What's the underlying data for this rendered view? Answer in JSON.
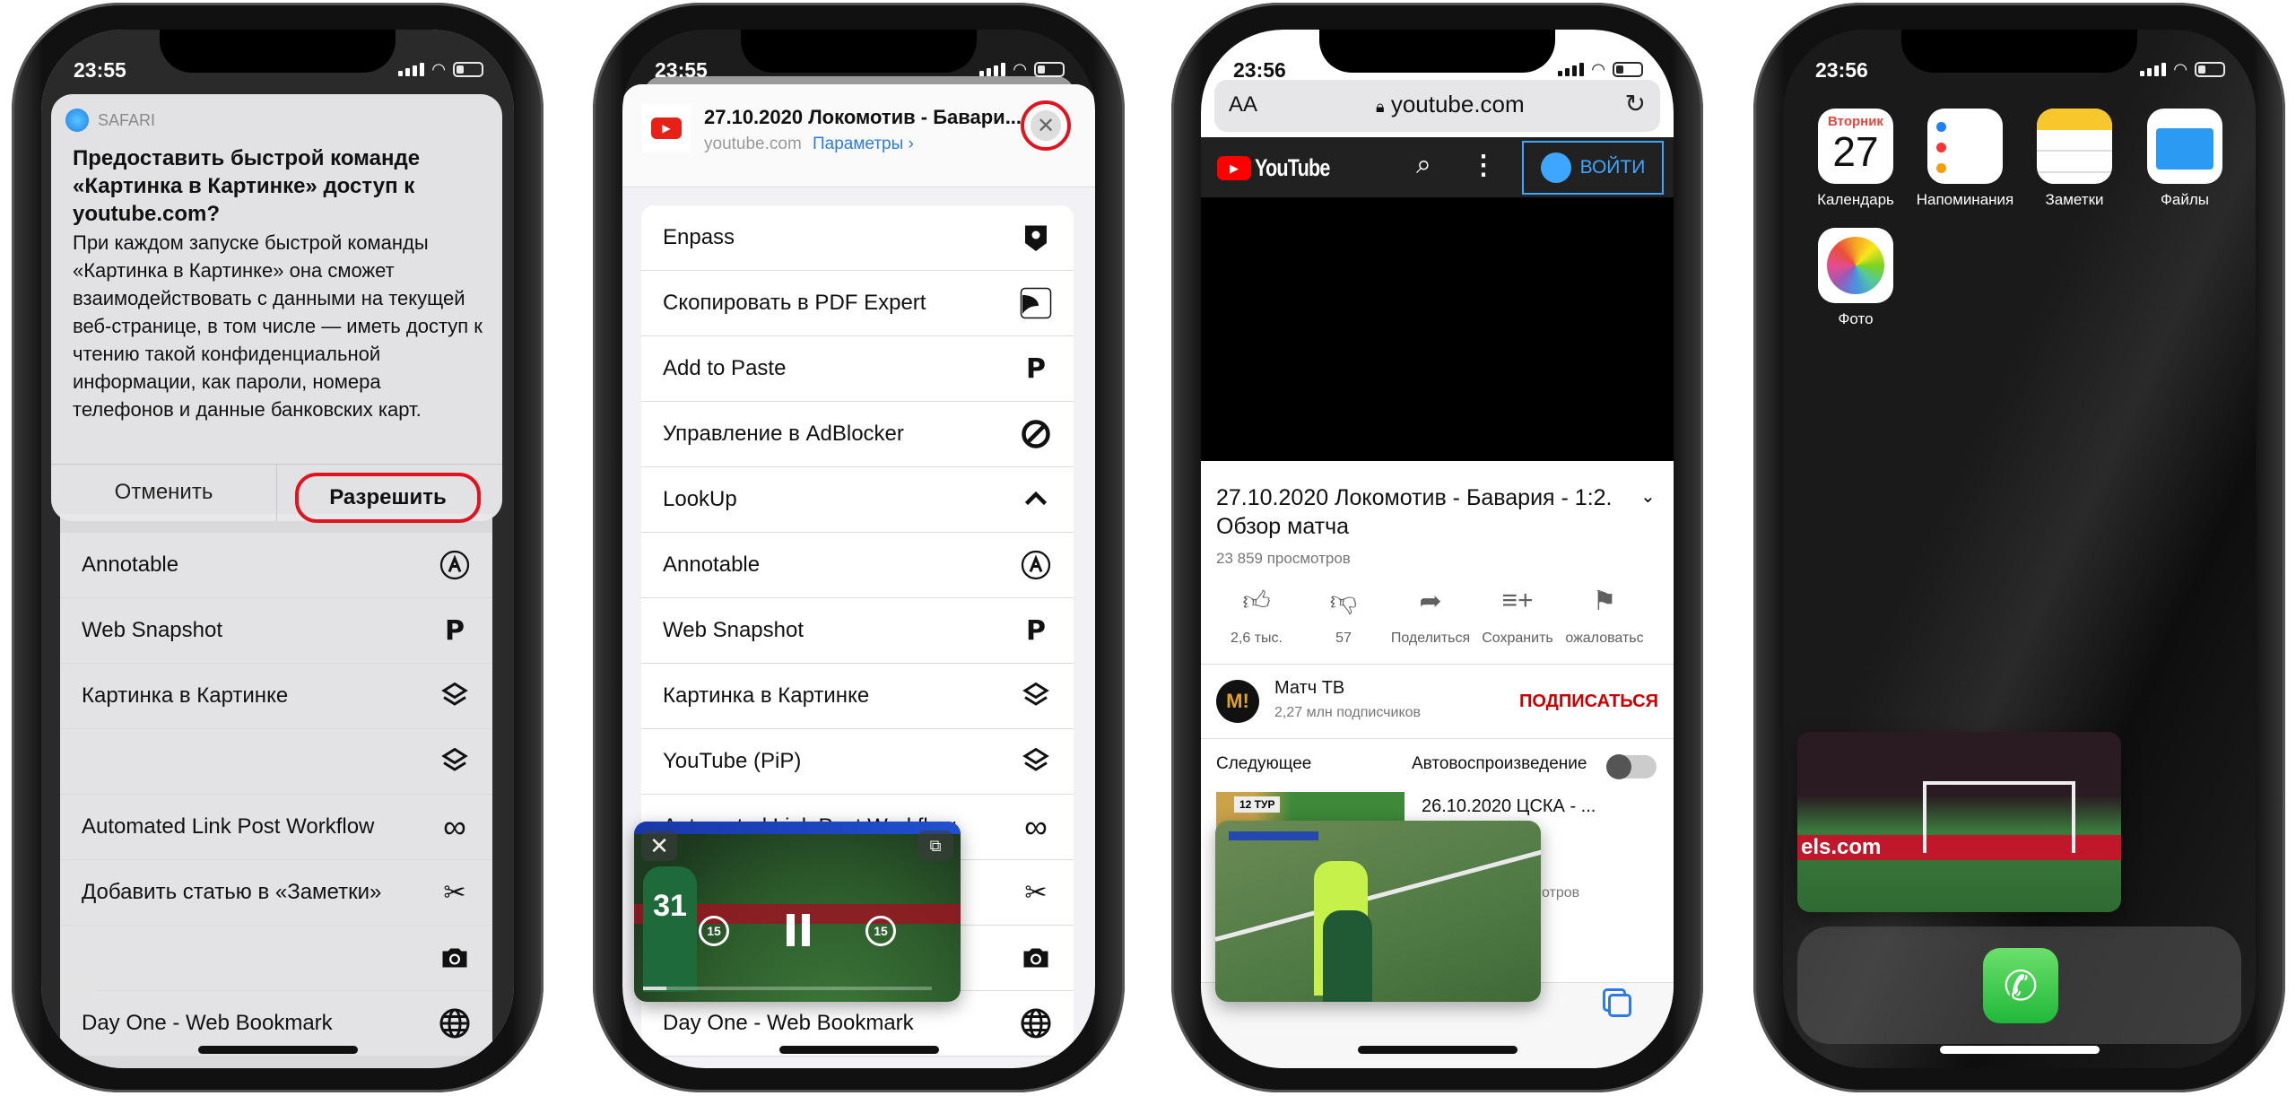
{
  "phone1": {
    "time": "23:55",
    "alert": {
      "app": "SAFARI",
      "title": "Предоставить быстрой команде «Картинка в Картинке» доступ к youtube.com?",
      "body": "При каждом запуске быстрой команды «Картинка в Картинке» она сможет взаимодействовать с данными на текущей веб-странице, в том числе — иметь доступ к чтению такой конфиденциальной информации, как пароли, номера телефонов и данные банковских карт.",
      "cancel": "Отменить",
      "allow": "Разрешить",
      "highlight_color": "#e0141e"
    },
    "rows": [
      {
        "label": "Annotable",
        "icon": "annotable-icon"
      },
      {
        "label": "Web Snapshot",
        "icon": "p-icon"
      },
      {
        "label": "Картинка в Картинке",
        "icon": "layers-icon"
      },
      {
        "label": "",
        "icon": "layers-icon"
      },
      {
        "label": "Automated Link Post Workflow",
        "icon": "infinity-icon"
      },
      {
        "label": "Добавить статью в «Заметки»",
        "icon": "scissors-icon"
      },
      {
        "label": "",
        "icon": "camera-icon"
      },
      {
        "label": "Day One - Web Bookmark",
        "icon": "globe-icon"
      }
    ]
  },
  "phone2": {
    "time": "23:55",
    "header": {
      "title": "27.10.2020 Локомотив - Бавари...",
      "domain": "youtube.com",
      "options": "Параметры ›"
    },
    "rows": [
      {
        "label": "Enpass",
        "icon": "enpass-icon"
      },
      {
        "label": "Скопировать в PDF Expert",
        "icon": "pdf-expert-icon"
      },
      {
        "label": "Add to Paste",
        "icon": "p-icon"
      },
      {
        "label": "Управление в AdBlocker",
        "icon": "block-icon"
      },
      {
        "label": "LookUp",
        "icon": "chevron-up-icon"
      },
      {
        "label": "Annotable",
        "icon": "annotable-icon"
      },
      {
        "label": "Web Snapshot",
        "icon": "p-icon"
      },
      {
        "label": "Картинка в Картинке",
        "icon": "layers-icon"
      },
      {
        "label": "YouTube (PiP)",
        "icon": "layers-icon"
      },
      {
        "label": "Automated Link Post Workflow",
        "icon": "infinity-icon"
      },
      {
        "label": "",
        "icon": "scissors-icon"
      },
      {
        "label": "",
        "icon": "camera-icon"
      },
      {
        "label": "Day One - Web Bookmark",
        "icon": "globe-icon"
      }
    ],
    "pip": {
      "skip_back": "15",
      "skip_fwd": "15",
      "progress": 0.08
    }
  },
  "phone3": {
    "time": "23:56",
    "url": "youtube.com",
    "aa": "AA",
    "yt": {
      "logo": "YouTube",
      "signin": "ВОЙТИ"
    },
    "video": {
      "title": "27.10.2020 Локомотив - Бавария - 1:2. Обзор матча",
      "views": "23 859 просмотров",
      "actions": [
        {
          "label": "2,6 тыс.",
          "icon": "thumbs-up-icon"
        },
        {
          "label": "57",
          "icon": "thumbs-down-icon"
        },
        {
          "label": "Поделиться",
          "icon": "share-icon"
        },
        {
          "label": "Сохранить",
          "icon": "add-to-playlist-icon"
        },
        {
          "label": "ожаловатьс",
          "icon": "flag-icon"
        }
      ],
      "channel": "Матч ТВ",
      "subscribers": "2,27 млн подписчиков",
      "subscribe": "ПОДПИСАТЬСЯ",
      "next": "Следующее",
      "autoplay": "Автовоспроизведение",
      "autoplay_on": false,
      "next_title": "26.10.2020 ЦСКА - ... Обзор...",
      "next_badge": "12 ТУР",
      "next_views_partial": "отров"
    },
    "accent": "#cc0000"
  },
  "phone4": {
    "time": "23:56",
    "apps": [
      {
        "label": "Календарь",
        "icon": "calendar-icon",
        "day": "Вторник",
        "date": "27"
      },
      {
        "label": "Напоминания",
        "icon": "reminders-icon"
      },
      {
        "label": "Заметки",
        "icon": "notes-icon"
      },
      {
        "label": "Файлы",
        "icon": "files-icon"
      },
      {
        "label": "Фото",
        "icon": "photos-icon"
      }
    ],
    "dock": [
      {
        "icon": "phone-icon"
      }
    ]
  }
}
